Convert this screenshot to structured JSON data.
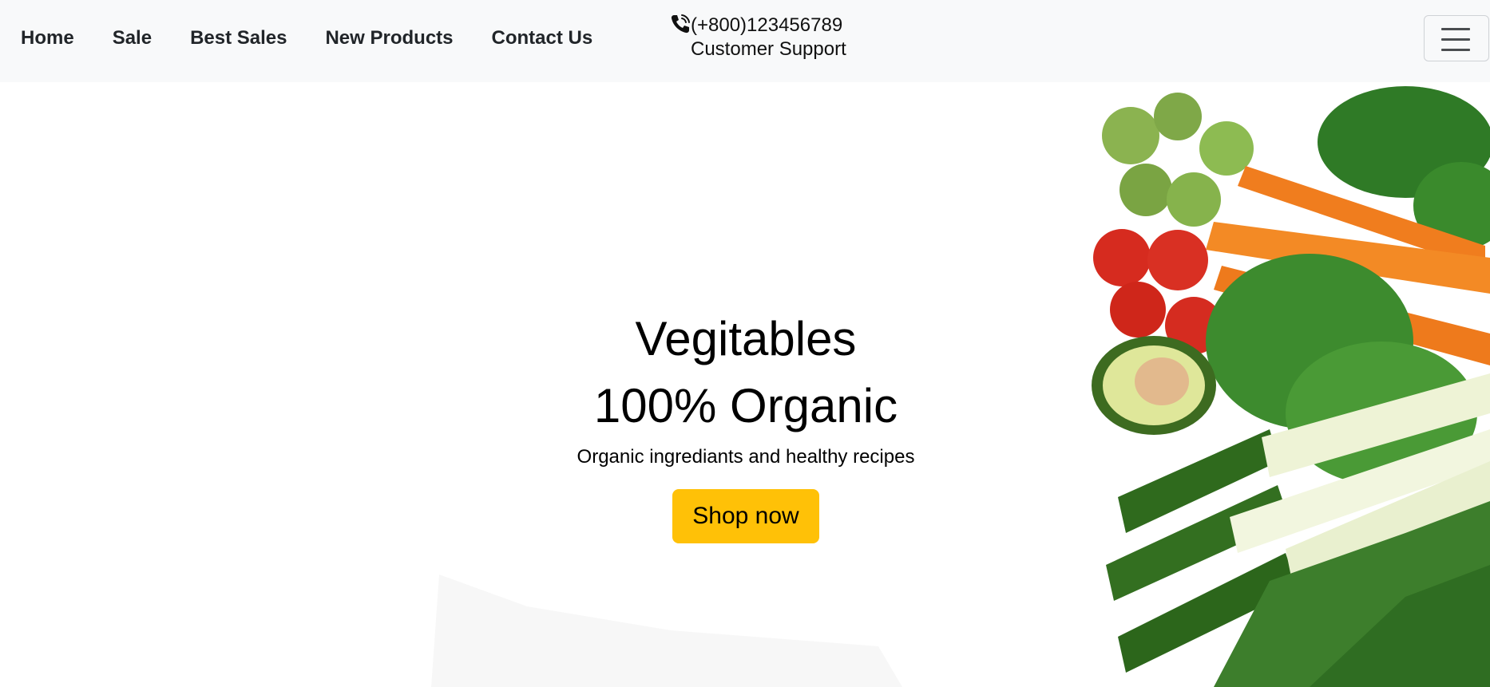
{
  "nav": {
    "links": [
      "Home",
      "Sale",
      "Best Sales",
      "New Products",
      "Contact Us"
    ],
    "support": {
      "phone": "(+800)123456789",
      "label": "Customer Support",
      "icon": "phone-call-icon"
    },
    "toggler_icon": "hamburger-menu-icon"
  },
  "hero": {
    "title": "Vegitables",
    "subtitle": "100% Organic",
    "tagline": "Organic ingrediants and healthy recipes",
    "button_label": "Shop now",
    "image": "vegetables-illustration"
  },
  "colors": {
    "navbar_bg": "#f8f9fa",
    "button_bg": "#ffc107",
    "text": "#000000"
  }
}
